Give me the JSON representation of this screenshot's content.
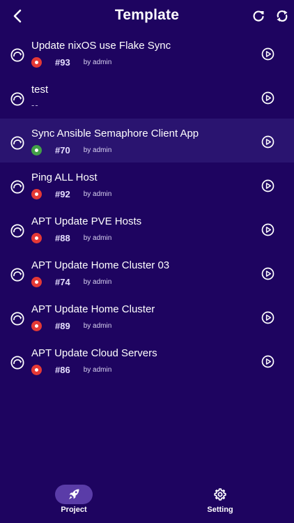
{
  "header": {
    "title": "Template",
    "back_icon": "chevron-left-icon",
    "refresh_icon": "refresh-icon",
    "sync_icon": "sync-icon"
  },
  "colors": {
    "background": "#1e0460",
    "highlight_row": "#2a1470",
    "status_failed": "#e53935",
    "status_success": "#43a047",
    "nav_active": "#5a3ca8"
  },
  "templates": [
    {
      "name": "Update nixOS use Flake Sync",
      "status": "failed",
      "task": "#93",
      "by": "by admin"
    },
    {
      "name": "test",
      "placeholder": "--"
    },
    {
      "name": "Sync Ansible Semaphore Client App",
      "status": "success",
      "task": "#70",
      "by": "by admin"
    },
    {
      "name": "Ping ALL Host",
      "status": "failed",
      "task": "#92",
      "by": "by admin"
    },
    {
      "name": "APT Update PVE Hosts",
      "status": "failed",
      "task": "#88",
      "by": "by admin"
    },
    {
      "name": "APT Update Home Cluster 03",
      "status": "failed",
      "task": "#74",
      "by": "by admin"
    },
    {
      "name": "APT Update Home Cluster",
      "status": "failed",
      "task": "#89",
      "by": "by admin"
    },
    {
      "name": "APT Update Cloud Servers",
      "status": "failed",
      "task": "#86",
      "by": "by admin"
    }
  ],
  "nav": {
    "project_label": "Project",
    "project_icon": "rocket-icon",
    "setting_label": "Setting",
    "setting_icon": "gear-icon"
  }
}
